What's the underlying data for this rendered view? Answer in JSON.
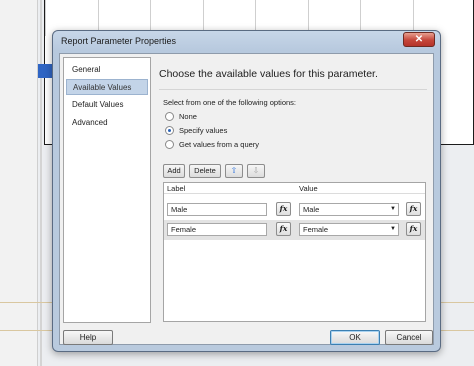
{
  "dialog": {
    "title": "Report Parameter Properties",
    "close_glyph": "✕"
  },
  "nav": {
    "items": [
      {
        "label": "General",
        "selected": false
      },
      {
        "label": "Available Values",
        "selected": true
      },
      {
        "label": "Default Values",
        "selected": false
      },
      {
        "label": "Advanced",
        "selected": false
      }
    ]
  },
  "main": {
    "heading": "Choose the available values for this parameter.",
    "select_prompt": "Select from one of the following options:",
    "options": [
      {
        "label": "None",
        "checked": false
      },
      {
        "label": "Specify values",
        "checked": true
      },
      {
        "label": "Get values from a query",
        "checked": false
      }
    ]
  },
  "toolbar": {
    "add_label": "Add",
    "delete_label": "Delete",
    "move_up_icon": "up-arrow-icon",
    "move_down_icon": "down-arrow-icon",
    "up_glyph": "⇧",
    "down_glyph": "⇩"
  },
  "grid": {
    "columns": [
      "Label",
      "Value"
    ],
    "rows": [
      {
        "label": "Male",
        "value": "Male"
      },
      {
        "label": "Female",
        "value": "Female"
      }
    ],
    "fx_label": "fx",
    "dropdown_glyph": "▼"
  },
  "footer": {
    "help_label": "Help",
    "ok_label": "OK",
    "cancel_label": "Cancel"
  },
  "colors": {
    "selection": "#c3d4e8",
    "close_button": "#c5463a",
    "radio_dot": "#2b63b8"
  }
}
